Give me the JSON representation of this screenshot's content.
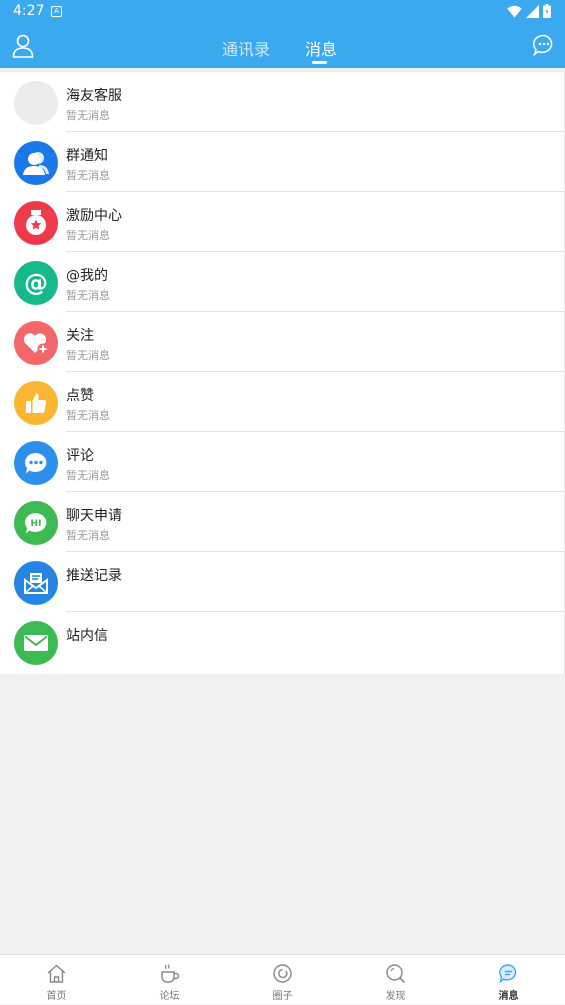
{
  "statusbar": {
    "time": "4:27",
    "notif_icon": "A"
  },
  "header": {
    "tabs": [
      {
        "label": "通讯录",
        "active": false
      },
      {
        "label": "消息",
        "active": true
      }
    ]
  },
  "messages": [
    {
      "name": "海友客服",
      "sub": "暂无消息",
      "icon": "blank-avatar",
      "color": "#ececec"
    },
    {
      "name": "群通知",
      "sub": "暂无消息",
      "icon": "group-icon",
      "color": "#1a78e8"
    },
    {
      "name": "激励中心",
      "sub": "暂无消息",
      "icon": "medal-icon",
      "color": "#ef3a4b"
    },
    {
      "name": "@我的",
      "sub": "暂无消息",
      "icon": "at-icon",
      "color": "#16b98c"
    },
    {
      "name": "关注",
      "sub": "暂无消息",
      "icon": "heart-plus-icon",
      "color": "#f3666a"
    },
    {
      "name": "点赞",
      "sub": "暂无消息",
      "icon": "thumbs-up-icon",
      "color": "#fbb733"
    },
    {
      "name": "评论",
      "sub": "暂无消息",
      "icon": "comment-icon",
      "color": "#2d90ec"
    },
    {
      "name": "聊天申请",
      "sub": "暂无消息",
      "icon": "chat-hi-icon",
      "color": "#3cbb54"
    },
    {
      "name": "推送记录",
      "sub": "",
      "icon": "push-mail-icon",
      "color": "#2585e3"
    },
    {
      "name": "站内信",
      "sub": "",
      "icon": "mail-icon",
      "color": "#3cbb54"
    }
  ],
  "bottom_nav": [
    {
      "label": "首页",
      "icon": "home-icon",
      "active": false
    },
    {
      "label": "论坛",
      "icon": "cup-icon",
      "active": false
    },
    {
      "label": "圈子",
      "icon": "circle-icon",
      "active": false
    },
    {
      "label": "发现",
      "icon": "discover-icon",
      "active": false
    },
    {
      "label": "消息",
      "icon": "message-icon",
      "active": true
    }
  ],
  "colors": {
    "accent": "#3aa9f0",
    "active_nav": "#3aa9f0"
  }
}
